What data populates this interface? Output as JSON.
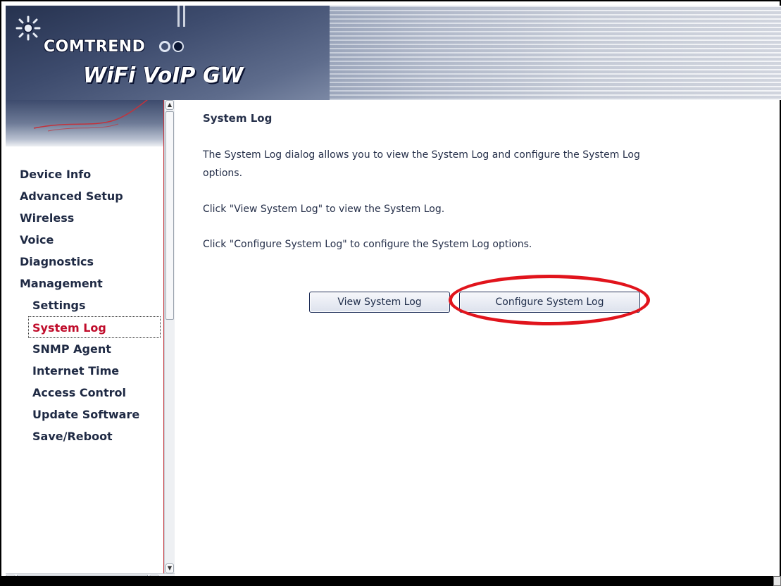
{
  "banner": {
    "brand": "COMTREND",
    "product": "WiFi VoIP GW"
  },
  "sidebar": {
    "items": [
      {
        "label": "Device Info",
        "level": "top"
      },
      {
        "label": "Advanced Setup",
        "level": "top"
      },
      {
        "label": "Wireless",
        "level": "top"
      },
      {
        "label": "Voice",
        "level": "top"
      },
      {
        "label": "Diagnostics",
        "level": "top"
      },
      {
        "label": "Management",
        "level": "top"
      },
      {
        "label": "Settings",
        "level": "sub"
      },
      {
        "label": "System Log",
        "level": "sub",
        "active": true
      },
      {
        "label": "SNMP Agent",
        "level": "sub"
      },
      {
        "label": "Internet Time",
        "level": "sub"
      },
      {
        "label": "Access Control",
        "level": "sub"
      },
      {
        "label": "Update Software",
        "level": "sub"
      },
      {
        "label": "Save/Reboot",
        "level": "sub"
      }
    ]
  },
  "main": {
    "title": "System Log",
    "desc_line1": "The System Log dialog allows you to view the System Log and configure the System Log",
    "desc_line2": "options.",
    "instr_view": "Click \"View System Log\" to view the System Log.",
    "instr_configure": "Click \"Configure System Log\" to configure the System Log options.",
    "buttons": {
      "view": "View System Log",
      "configure": "Configure System Log"
    }
  },
  "colors": {
    "active_menu": "#c00c2b",
    "menu_text": "#1f2a44",
    "highlight_ring": "#e1141c",
    "sidebar_border": "#c3323b"
  }
}
